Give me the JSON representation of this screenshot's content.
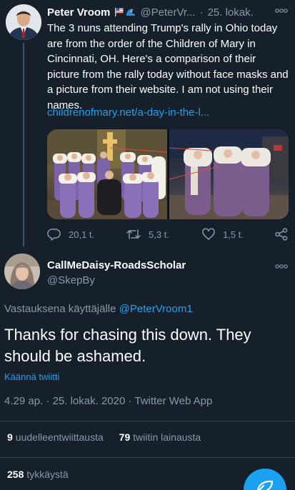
{
  "tweet": {
    "author_name": "Peter Vroom",
    "author_handle": "@PeterVr...",
    "date": "25. lokak.",
    "text": "The 3 nuns attending Trump's rally in Ohio today are from the order of the Children of Mary in Cincinnati, OH. Here's a comparison of their picture from the rally today without face masks and a picture from their website. I am not using their names.",
    "link": "childrenofmary.net/a-day-in-the-l...",
    "emoji_icons": [
      "flag-icon",
      "wave-icon"
    ],
    "actions": {
      "reply_count": "20,1 t.",
      "retweet_count": "5,3 t.",
      "like_count": "1,5 t."
    }
  },
  "reply": {
    "author_name": "CallMeDaisy-RoadsScholar",
    "author_handle": "@SkepBy",
    "replying_to_prefix": "Vastauksena käyttäjälle",
    "replying_to_handle": "@PeterVroom1",
    "text": "Thanks for chasing this down. They should be ashamed.",
    "translate_label": "Käännä twiitti",
    "time": "4.29 ap.",
    "date": "25. lokak. 2020",
    "app": "Twitter Web App",
    "separator": "·",
    "stats": {
      "retweets_count": "9",
      "retweets_label": "uudelleentwiittausta",
      "quotes_count": "79",
      "quotes_label": "twiitin lainausta",
      "likes_count": "258",
      "likes_label": "tykkäystä"
    }
  },
  "colors": {
    "background": "#15202b",
    "accent": "#1da1f2",
    "secondary_text": "#8899a6",
    "divider": "#38444d"
  },
  "icons": {
    "more": "more-horizontal-icon",
    "reply": "reply-icon",
    "retweet": "retweet-icon",
    "like": "heart-icon",
    "share": "share-icon",
    "compose": "compose-icon"
  }
}
